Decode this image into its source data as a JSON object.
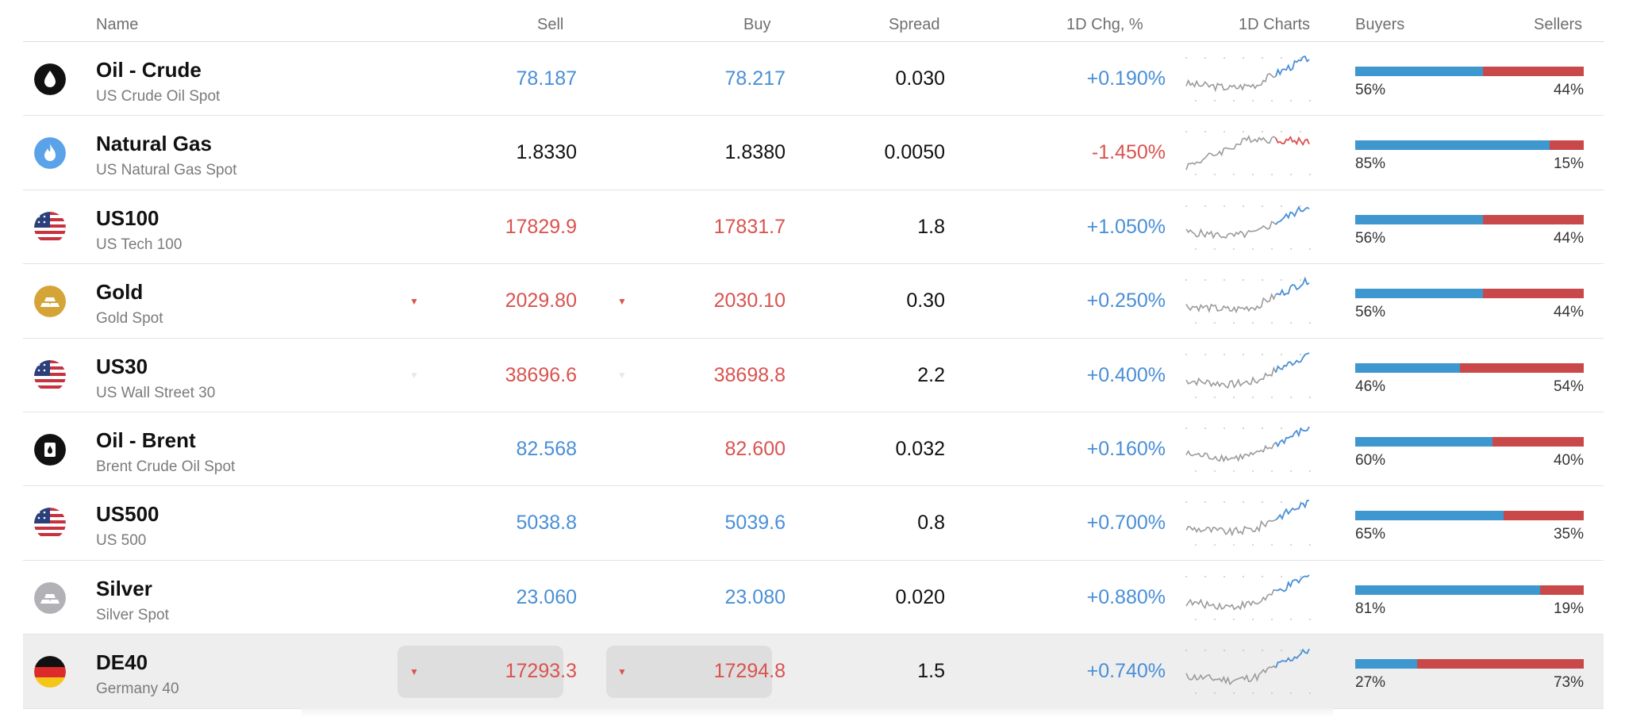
{
  "header": {
    "name": "Name",
    "sell": "Sell",
    "buy": "Buy",
    "spread": "Spread",
    "chg": "1D Chg, %",
    "charts": "1D Charts",
    "buyers": "Buyers",
    "sellers": "Sellers"
  },
  "colors": {
    "up": "#4a8fd6",
    "down": "#d9534f",
    "buyers_bar": "#3f97cf",
    "sellers_bar": "#c9494a"
  },
  "rows": [
    {
      "icon": "oil-drop-icon",
      "name": "Oil - Crude",
      "subtitle": "US Crude Oil Spot",
      "sell": "78.187",
      "sell_color": "blue",
      "buy": "78.217",
      "buy_color": "blue",
      "spread": "0.030",
      "chg": "+0.190%",
      "chg_color": "blue",
      "buyers": "56%",
      "sellers": "44%",
      "buyers_frac": 0.56,
      "spark_trend": "up",
      "arrows": "none",
      "highlight": false
    },
    {
      "icon": "flame-icon",
      "name": "Natural Gas",
      "subtitle": "US Natural Gas Spot",
      "sell": "1.8330",
      "sell_color": "dark",
      "buy": "1.8380",
      "buy_color": "dark",
      "spread": "0.0050",
      "chg": "-1.450%",
      "chg_color": "red",
      "buyers": "85%",
      "sellers": "15%",
      "buyers_frac": 0.85,
      "spark_trend": "down",
      "arrows": "none",
      "highlight": false
    },
    {
      "icon": "us-flag-icon",
      "name": "US100",
      "subtitle": "US Tech 100",
      "sell": "17829.9",
      "sell_color": "red",
      "buy": "17831.7",
      "buy_color": "red",
      "spread": "1.8",
      "chg": "+1.050%",
      "chg_color": "blue",
      "buyers": "56%",
      "sellers": "44%",
      "buyers_frac": 0.56,
      "spark_trend": "up",
      "arrows": "none",
      "highlight": false
    },
    {
      "icon": "gold-bars-icon",
      "name": "Gold",
      "subtitle": "Gold Spot",
      "sell": "2029.80",
      "sell_color": "red",
      "buy": "2030.10",
      "buy_color": "red",
      "spread": "0.30",
      "chg": "+0.250%",
      "chg_color": "blue",
      "buyers": "56%",
      "sellers": "44%",
      "buyers_frac": 0.56,
      "spark_trend": "up",
      "arrows": "strong",
      "highlight": false
    },
    {
      "icon": "us-flag-icon",
      "name": "US30",
      "subtitle": "US Wall Street 30",
      "sell": "38696.6",
      "sell_color": "red",
      "buy": "38698.8",
      "buy_color": "red",
      "spread": "2.2",
      "chg": "+0.400%",
      "chg_color": "blue",
      "buyers": "46%",
      "sellers": "54%",
      "buyers_frac": 0.46,
      "spark_trend": "up",
      "arrows": "faint",
      "highlight": false
    },
    {
      "icon": "oil-barrel-icon",
      "name": "Oil - Brent",
      "subtitle": "Brent Crude Oil Spot",
      "sell": "82.568",
      "sell_color": "blue",
      "buy": "82.600",
      "buy_color": "red",
      "spread": "0.032",
      "chg": "+0.160%",
      "chg_color": "blue",
      "buyers": "60%",
      "sellers": "40%",
      "buyers_frac": 0.6,
      "spark_trend": "up",
      "arrows": "none",
      "highlight": false
    },
    {
      "icon": "us-flag-icon",
      "name": "US500",
      "subtitle": "US 500",
      "sell": "5038.8",
      "sell_color": "blue",
      "buy": "5039.6",
      "buy_color": "blue",
      "spread": "0.8",
      "chg": "+0.700%",
      "chg_color": "blue",
      "buyers": "65%",
      "sellers": "35%",
      "buyers_frac": 0.65,
      "spark_trend": "up",
      "arrows": "none",
      "highlight": false
    },
    {
      "icon": "silver-bars-icon",
      "name": "Silver",
      "subtitle": "Silver Spot",
      "sell": "23.060",
      "sell_color": "blue",
      "buy": "23.080",
      "buy_color": "blue",
      "spread": "0.020",
      "chg": "+0.880%",
      "chg_color": "blue",
      "buyers": "81%",
      "sellers": "19%",
      "buyers_frac": 0.81,
      "spark_trend": "up",
      "arrows": "none",
      "highlight": false
    },
    {
      "icon": "de-flag-icon",
      "name": "DE40",
      "subtitle": "Germany 40",
      "sell": "17293.3",
      "sell_color": "red",
      "buy": "17294.8",
      "buy_color": "red",
      "spread": "1.5",
      "chg": "+0.740%",
      "chg_color": "blue",
      "buyers": "27%",
      "sellers": "73%",
      "buyers_frac": 0.27,
      "spark_trend": "up",
      "arrows": "strong",
      "highlight": true
    }
  ]
}
